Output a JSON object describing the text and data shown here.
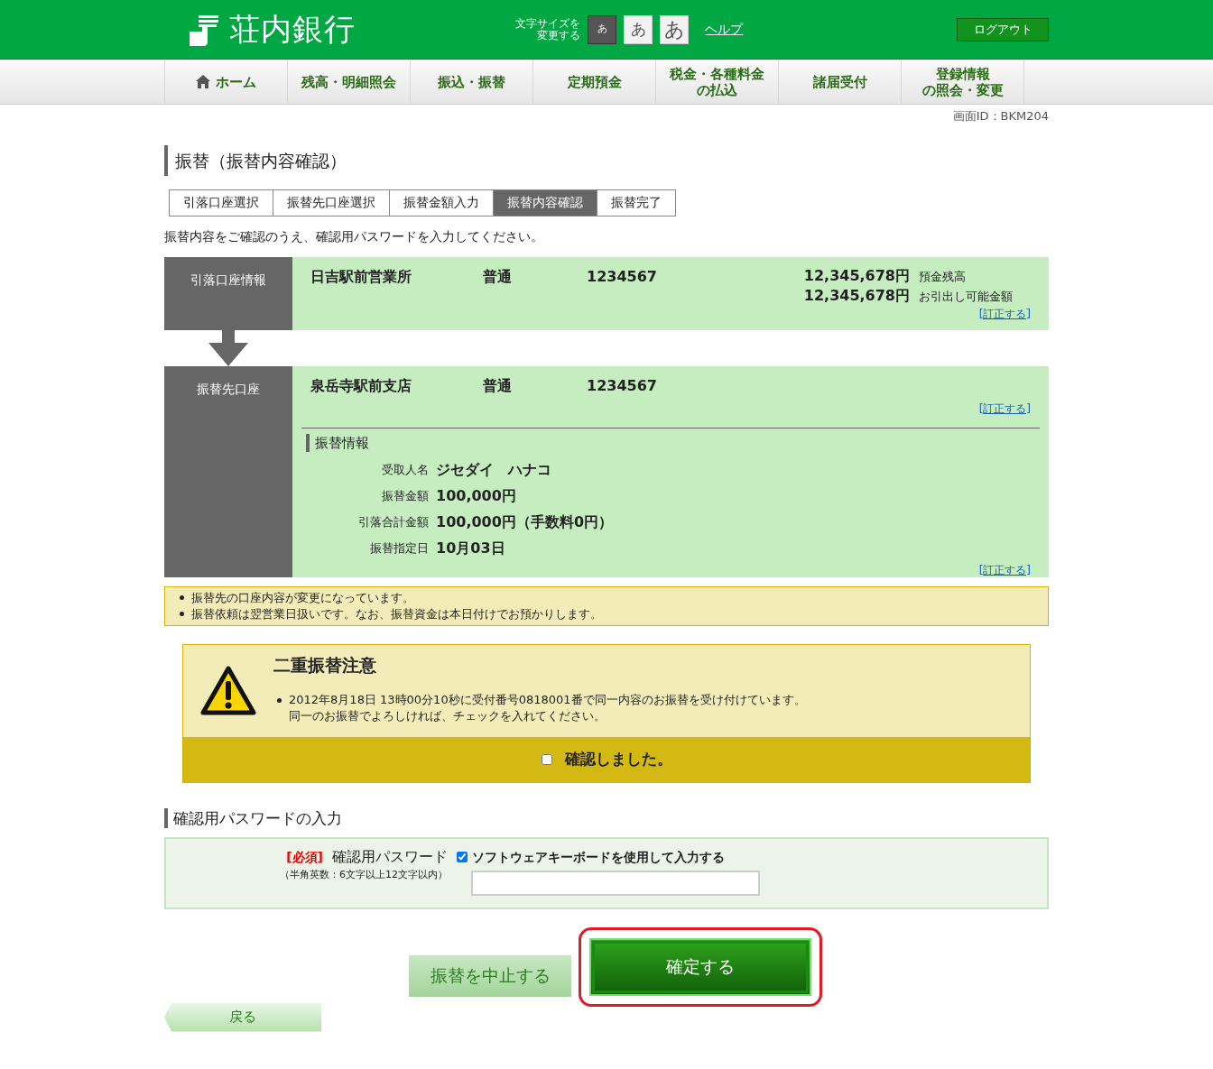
{
  "header": {
    "logo_text": "荘内銀行",
    "font_size_label": [
      "文字サイズを",
      "変更する"
    ],
    "font_sizes": [
      {
        "label": "あ",
        "selected": true
      },
      {
        "label": "あ",
        "selected": false
      },
      {
        "label": "あ",
        "selected": false
      }
    ],
    "help_link": "ヘルプ",
    "logout_button": "ログアウト"
  },
  "nav": [
    {
      "label": "ホーム",
      "kind": "home"
    },
    {
      "label": "残高・明細照会",
      "kind": "text"
    },
    {
      "label": "振込・振替",
      "kind": "text"
    },
    {
      "label": "定期預金",
      "kind": "text"
    },
    {
      "label": [
        "税金・各種料金",
        "の払込"
      ],
      "kind": "text"
    },
    {
      "label": "諸届受付",
      "kind": "text"
    },
    {
      "label": [
        "登録情報",
        "の照会・変更"
      ],
      "kind": "text"
    }
  ],
  "screen_id": "画面ID：BKM204",
  "page_title": "振替（振替内容確認）",
  "steps": [
    {
      "label": "引落口座選択",
      "selected": false
    },
    {
      "label": "振替先口座選択",
      "selected": false
    },
    {
      "label": "振替金額入力",
      "selected": false
    },
    {
      "label": "振替内容確認",
      "selected": true
    },
    {
      "label": "振替完了",
      "selected": false
    }
  ],
  "instruction": "振替内容をご確認のうえ、確認用パスワードを入力してください。",
  "source_account": {
    "label": "引落口座情報",
    "branch": "日吉駅前営業所",
    "type": "普通",
    "number": "1234567",
    "balances": [
      {
        "amount": "12,345,678円",
        "label": "預金残高"
      },
      {
        "amount": "12,345,678円",
        "label": "お引出し可能金額"
      }
    ],
    "edit_link": "[訂正する]"
  },
  "destination": {
    "label": "振替先口座",
    "branch": "泉岳寺駅前支店",
    "type": "普通",
    "number": "1234567",
    "edit_link": "[訂正する]",
    "transfer_info": {
      "title": "振替情報",
      "rows": [
        {
          "label": "受取人名",
          "value": "ジセダイ　ハナコ"
        },
        {
          "label": "振替金額",
          "value": "100,000円"
        },
        {
          "label": "引落合計金額",
          "value": "100,000円（手数料0円）"
        },
        {
          "label": "振替指定日",
          "value": "10月03日"
        }
      ],
      "edit_link": "[訂正する]"
    }
  },
  "notices": [
    "振替先の口座内容が変更になっています。",
    "振替依頼は翌営業日扱いです。なお、振替資金は本日付けでお預かりします。"
  ],
  "warning": {
    "title": "二重振替注意",
    "message": [
      "2012年8月18日 13時00分10秒に受付番号0818001番で同一内容のお振替を受け付けています。",
      "同一のお振替でよろしければ、チェックを入れてください。"
    ],
    "confirm": {
      "label": "確認しました。",
      "checked": false
    }
  },
  "password_section": {
    "title": "確認用パスワードの入力",
    "required_tag": "[必須]",
    "label": "確認用パスワード",
    "hint": "（半角英数：6文字以上12文字以内）",
    "software_keyboard": {
      "label": "ソフトウェアキーボードを使用して入力する",
      "checked": true
    }
  },
  "buttons": {
    "cancel": "振替を中止する",
    "confirm": "確定する",
    "back": "戻る"
  }
}
